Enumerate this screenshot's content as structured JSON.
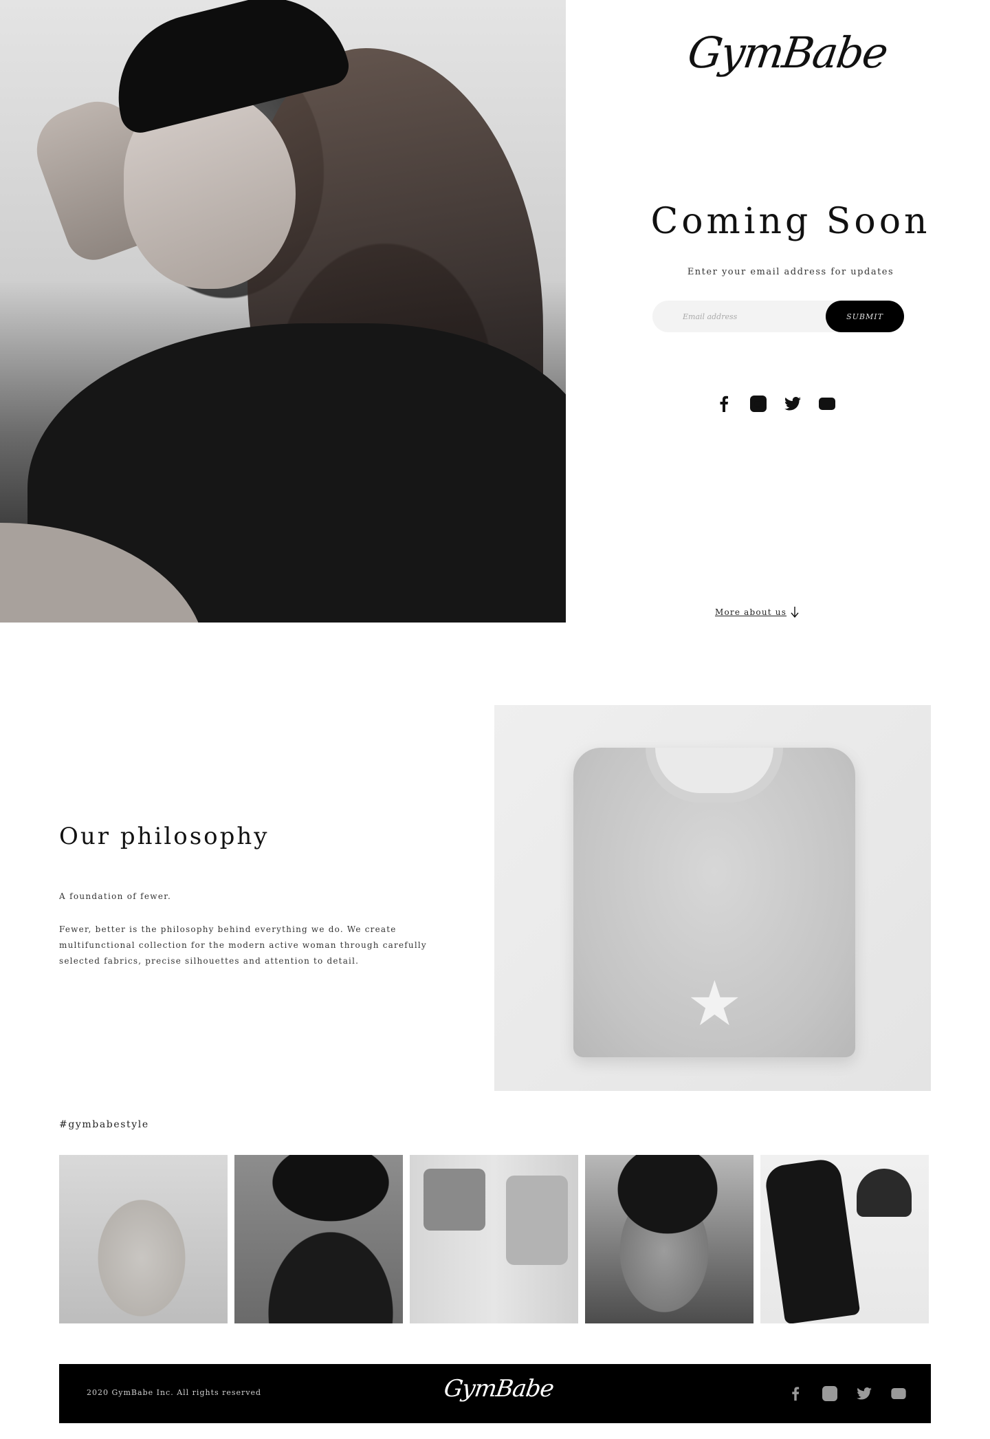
{
  "brand": {
    "name": "GymBabe"
  },
  "hero": {
    "title": "Coming Soon",
    "subtitle": "Enter your email address for updates",
    "email_placeholder": "Email address",
    "submit_label": "SUBMIT",
    "more_link": "More about us",
    "more_icon": "arrow-down-icon"
  },
  "social": {
    "icons": [
      "facebook-icon",
      "instagram-icon",
      "twitter-icon",
      "youtube-icon"
    ],
    "color": "#111111"
  },
  "philosophy": {
    "title": "Our philosophy",
    "tagline": "A foundation of fewer.",
    "body": "Fewer, better is the philosophy behind everything we do. We create multifunctional collection for the modern active woman through carefully selected fabrics, precise silhouettes and attention to detail."
  },
  "gallery": {
    "hashtag": "#gymbabestyle"
  },
  "footer": {
    "copyright": "2020 GymBabe Inc. All rights reserved",
    "logo": "GymBabe",
    "background": "#000000",
    "social_color": "#9a9a9a"
  }
}
